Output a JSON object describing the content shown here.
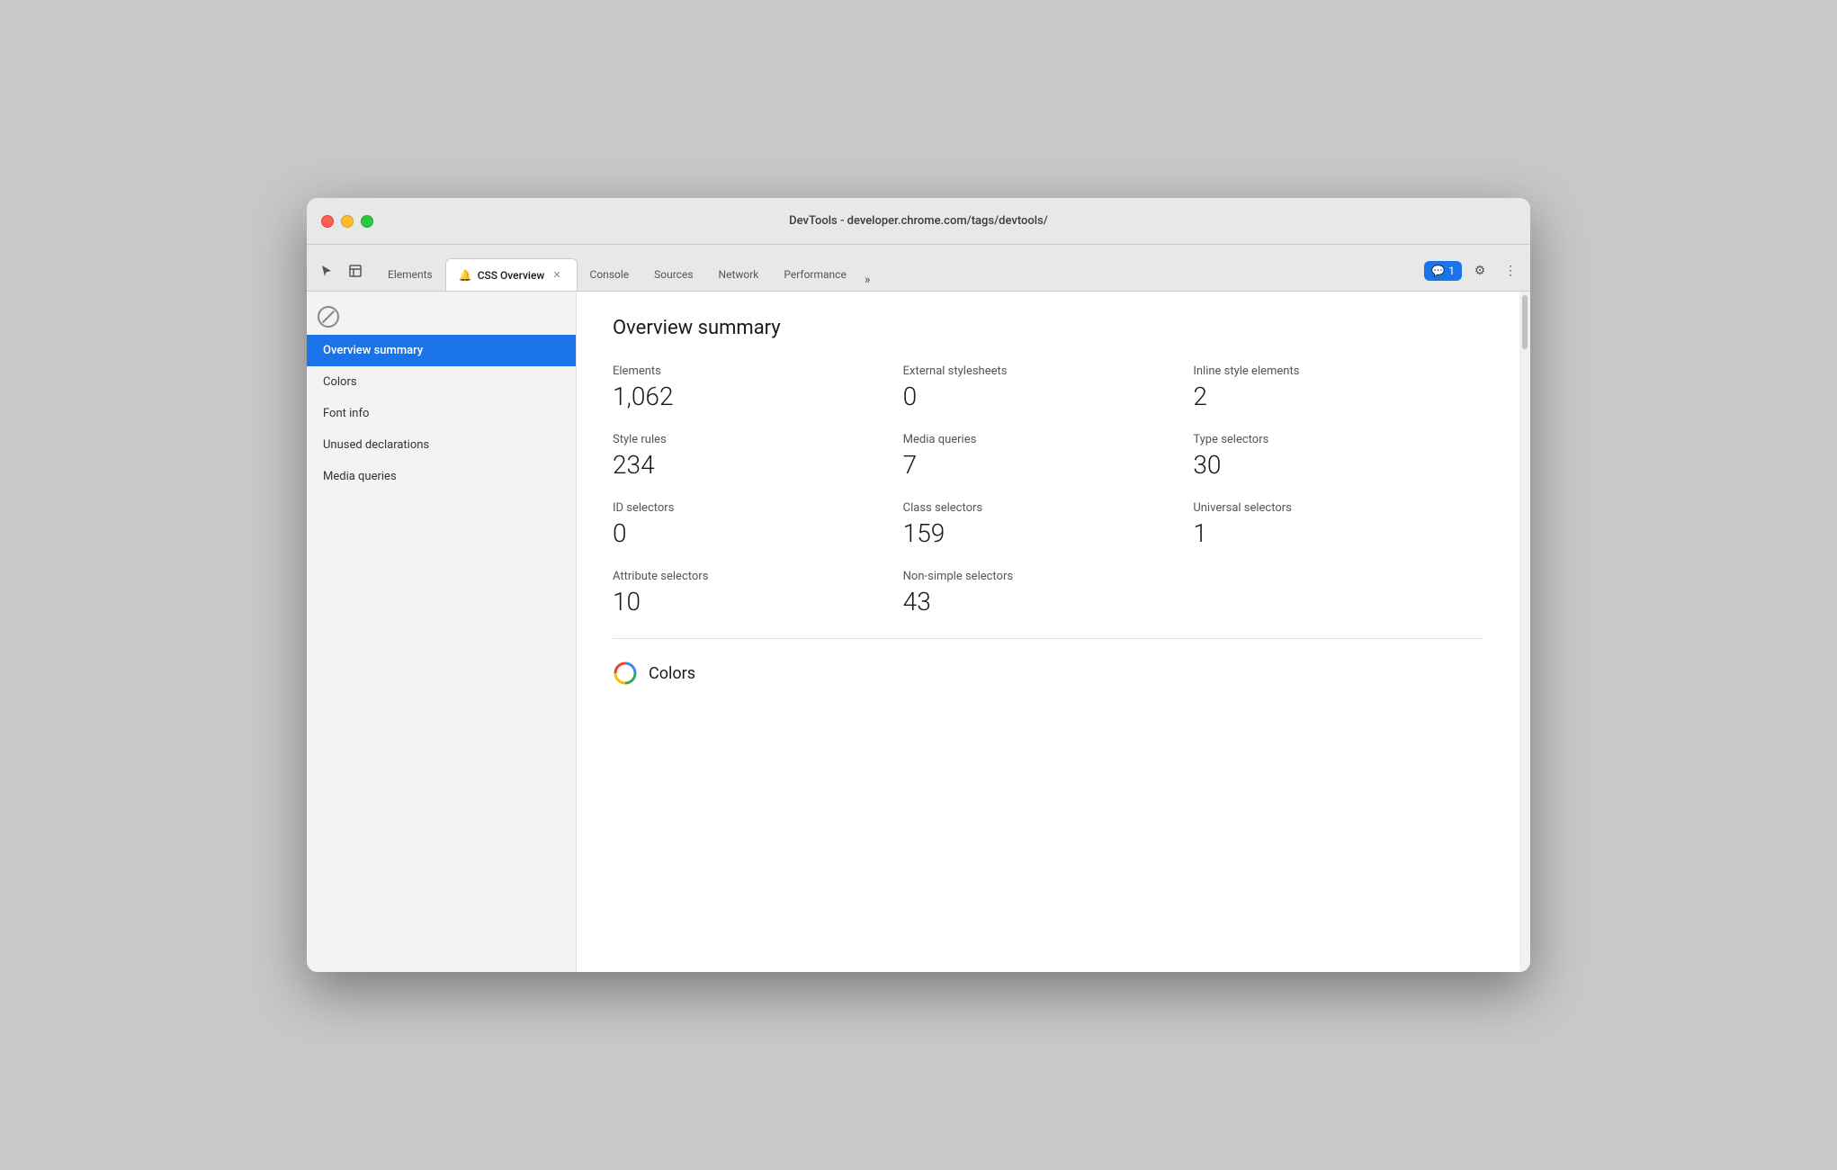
{
  "window": {
    "title": "DevTools - developer.chrome.com/tags/devtools/"
  },
  "tabbar": {
    "tabs": [
      {
        "id": "elements",
        "label": "Elements",
        "active": false,
        "closable": false
      },
      {
        "id": "css-overview",
        "label": "CSS Overview",
        "active": true,
        "closable": true,
        "has_icon": true
      },
      {
        "id": "console",
        "label": "Console",
        "active": false,
        "closable": false
      },
      {
        "id": "sources",
        "label": "Sources",
        "active": false,
        "closable": false
      },
      {
        "id": "network",
        "label": "Network",
        "active": false,
        "closable": false
      },
      {
        "id": "performance",
        "label": "Performance",
        "active": false,
        "closable": false
      }
    ],
    "more_tabs_label": "»",
    "notification_count": "1",
    "settings_icon": "⚙",
    "more_icon": "⋮"
  },
  "sidebar": {
    "nav_items": [
      {
        "id": "overview-summary",
        "label": "Overview summary",
        "active": true
      },
      {
        "id": "colors",
        "label": "Colors",
        "active": false
      },
      {
        "id": "font-info",
        "label": "Font info",
        "active": false
      },
      {
        "id": "unused-declarations",
        "label": "Unused declarations",
        "active": false
      },
      {
        "id": "media-queries",
        "label": "Media queries",
        "active": false
      }
    ]
  },
  "overview_summary": {
    "title": "Overview summary",
    "stats": [
      {
        "id": "elements",
        "label": "Elements",
        "value": "1,062"
      },
      {
        "id": "external-stylesheets",
        "label": "External stylesheets",
        "value": "0"
      },
      {
        "id": "inline-style-elements",
        "label": "Inline style elements",
        "value": "2"
      },
      {
        "id": "style-rules",
        "label": "Style rules",
        "value": "234"
      },
      {
        "id": "media-queries",
        "label": "Media queries",
        "value": "7"
      },
      {
        "id": "type-selectors",
        "label": "Type selectors",
        "value": "30"
      },
      {
        "id": "id-selectors",
        "label": "ID selectors",
        "value": "0"
      },
      {
        "id": "class-selectors",
        "label": "Class selectors",
        "value": "159"
      },
      {
        "id": "universal-selectors",
        "label": "Universal selectors",
        "value": "1"
      },
      {
        "id": "attribute-selectors",
        "label": "Attribute selectors",
        "value": "10"
      },
      {
        "id": "non-simple-selectors",
        "label": "Non-simple selectors",
        "value": "43"
      }
    ]
  },
  "colors_section": {
    "label": "Colors"
  }
}
